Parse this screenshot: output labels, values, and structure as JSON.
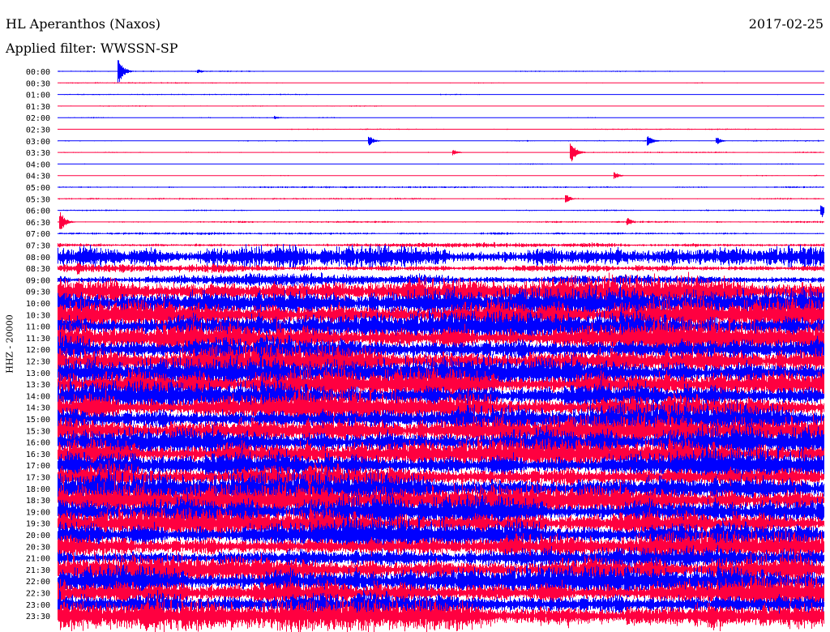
{
  "header": {
    "station": "HL Aperanthos (Naxos)",
    "filter": "Applied filter: WWSSN-SP",
    "date": "2017-02-25"
  },
  "chart_data": {
    "type": "line",
    "title": "HL Aperanthos (Naxos)",
    "subtitle": "Applied filter: WWSSN-SP",
    "ylabel": "HHZ - 20000",
    "xlabel": "",
    "row_minutes": 30,
    "colors": [
      "#0000ff",
      "#ff0040"
    ],
    "row_labels": [
      "00:00",
      "00:30",
      "01:00",
      "01:30",
      "02:00",
      "02:30",
      "03:00",
      "03:30",
      "04:00",
      "04:30",
      "05:00",
      "05:30",
      "06:00",
      "06:30",
      "07:00",
      "07:30",
      "08:00",
      "08:30",
      "09:00",
      "09:30",
      "10:00",
      "10:30",
      "11:00",
      "11:30",
      "12:00",
      "12:30",
      "13:00",
      "13:30",
      "14:00",
      "14:30",
      "15:00",
      "15:30",
      "16:00",
      "16:30",
      "17:00",
      "17:30",
      "18:00",
      "18:30",
      "19:00",
      "19:30",
      "20:00",
      "20:30",
      "21:00",
      "21:30",
      "22:00",
      "22:30",
      "23:00",
      "23:30"
    ],
    "relative_amplitude": [
      0.05,
      0.05,
      0.05,
      0.05,
      0.05,
      0.05,
      0.06,
      0.06,
      0.05,
      0.05,
      0.07,
      0.07,
      0.06,
      0.08,
      0.1,
      0.2,
      0.9,
      0.35,
      0.5,
      1.3,
      1.3,
      1.3,
      1.3,
      1.4,
      1.4,
      1.3,
      1.3,
      1.3,
      1.3,
      1.3,
      1.3,
      1.3,
      1.3,
      1.3,
      1.3,
      1.3,
      1.3,
      1.3,
      1.3,
      1.3,
      1.3,
      1.2,
      0.9,
      1.2,
      1.3,
      1.3,
      1.3,
      1.3
    ],
    "events": [
      {
        "row": 0,
        "minute": 2.4,
        "amplitude": 1.0
      },
      {
        "row": 0,
        "minute": 5.5,
        "amplitude": 0.2
      },
      {
        "row": 4,
        "minute": 8.5,
        "amplitude": 0.15
      },
      {
        "row": 6,
        "minute": 12.2,
        "amplitude": 0.4
      },
      {
        "row": 6,
        "minute": 23.1,
        "amplitude": 0.45
      },
      {
        "row": 6,
        "minute": 25.8,
        "amplitude": 0.3
      },
      {
        "row": 7,
        "minute": 20.1,
        "amplitude": 0.9
      },
      {
        "row": 7,
        "minute": 15.5,
        "amplitude": 0.25
      },
      {
        "row": 9,
        "minute": 21.8,
        "amplitude": 0.3
      },
      {
        "row": 11,
        "minute": 19.9,
        "amplitude": 0.35
      },
      {
        "row": 12,
        "minute": 29.9,
        "amplitude": 0.6
      },
      {
        "row": 13,
        "minute": 0.1,
        "amplitude": 0.9
      },
      {
        "row": 13,
        "minute": 22.3,
        "amplitude": 0.35
      },
      {
        "row": 17,
        "minute": 0.8,
        "amplitude": 0.6
      }
    ]
  }
}
